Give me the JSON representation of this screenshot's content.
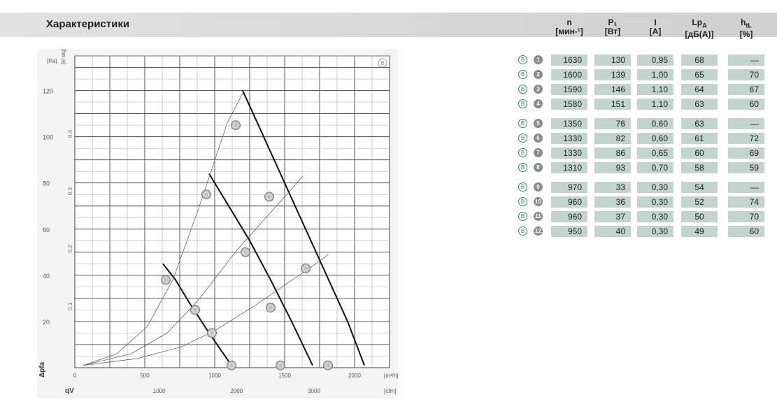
{
  "header": {
    "title": "Характеристики"
  },
  "table": {
    "columns": [
      {
        "name": "n",
        "unit": "[мин-¹]"
      },
      {
        "name": "P₁",
        "unit": "[Вт]"
      },
      {
        "name": "I",
        "unit": "[A]"
      },
      {
        "name": "Lp",
        "sub": "A",
        "unit": "[дБ(A)]"
      },
      {
        "name": "h",
        "sub": "tL",
        "unit": "[%]"
      }
    ],
    "rows": [
      {
        "badge": "B",
        "num": "1",
        "n": "1630",
        "p1": "130",
        "i": "0,95",
        "lpa": "68",
        "htl": "—"
      },
      {
        "badge": "B",
        "num": "2",
        "n": "1600",
        "p1": "139",
        "i": "1,00",
        "lpa": "65",
        "htl": "70"
      },
      {
        "badge": "B",
        "num": "3",
        "n": "1590",
        "p1": "146",
        "i": "1,10",
        "lpa": "64",
        "htl": "67"
      },
      {
        "badge": "B",
        "num": "4",
        "n": "1580",
        "p1": "151",
        "i": "1,10",
        "lpa": "63",
        "htl": "60"
      },
      {
        "badge": "B",
        "num": "5",
        "n": "1350",
        "p1": "76",
        "i": "0,60",
        "lpa": "63",
        "htl": "—"
      },
      {
        "badge": "B",
        "num": "6",
        "n": "1330",
        "p1": "82",
        "i": "0,60",
        "lpa": "61",
        "htl": "72"
      },
      {
        "badge": "B",
        "num": "7",
        "n": "1330",
        "p1": "86",
        "i": "0,65",
        "lpa": "60",
        "htl": "69"
      },
      {
        "badge": "B",
        "num": "8",
        "n": "1310",
        "p1": "93",
        "i": "0,70",
        "lpa": "58",
        "htl": "59"
      },
      {
        "badge": "B",
        "num": "9",
        "n": "970",
        "p1": "33",
        "i": "0,30",
        "lpa": "54",
        "htl": "—"
      },
      {
        "badge": "B",
        "num": "10",
        "n": "960",
        "p1": "36",
        "i": "0,30",
        "lpa": "52",
        "htl": "74"
      },
      {
        "badge": "B",
        "num": "11",
        "n": "960",
        "p1": "37",
        "i": "0,30",
        "lpa": "50",
        "htl": "70"
      },
      {
        "badge": "B",
        "num": "12",
        "n": "950",
        "p1": "40",
        "i": "0,30",
        "lpa": "49",
        "htl": "60"
      }
    ]
  },
  "chart_data": {
    "type": "line",
    "title": "",
    "corner_mark": "B",
    "x_axis_primary": {
      "label": "[m³/h]",
      "ticks": [
        "0",
        "500",
        "1000",
        "1500",
        "2000"
      ],
      "range": [
        0,
        2250
      ]
    },
    "x_axis_secondary": {
      "label": "[cfm]",
      "ticks": [
        "1000",
        "2000",
        "3000"
      ]
    },
    "y_axis_primary": {
      "label": "[Pa]",
      "ticks": [
        "20",
        "40",
        "60",
        "80",
        "100",
        "120"
      ],
      "range": [
        0,
        135
      ]
    },
    "y_axis_secondary": {
      "label": "[in wg]",
      "ticks": [
        "0.1",
        "0.2",
        "0.3",
        "0.4"
      ]
    },
    "x_symbol": "qV",
    "y_symbol": "Δpfa",
    "grid": true,
    "series": [
      {
        "kind": "fan-curve",
        "points": [
          [
            1200,
            120
          ],
          [
            1350,
            100
          ],
          [
            1500,
            80
          ],
          [
            1650,
            60
          ],
          [
            1800,
            40
          ],
          [
            1950,
            20
          ],
          [
            2070,
            1
          ]
        ]
      },
      {
        "kind": "fan-curve",
        "points": [
          [
            960,
            84
          ],
          [
            1100,
            70
          ],
          [
            1250,
            55
          ],
          [
            1400,
            38
          ],
          [
            1550,
            20
          ],
          [
            1700,
            1
          ]
        ]
      },
      {
        "kind": "fan-curve",
        "points": [
          [
            630,
            45
          ],
          [
            720,
            38
          ],
          [
            820,
            28
          ],
          [
            960,
            15
          ],
          [
            1120,
            1
          ]
        ]
      },
      {
        "kind": "system-curve",
        "points": [
          [
            60,
            1
          ],
          [
            300,
            6
          ],
          [
            520,
            18
          ],
          [
            700,
            38
          ],
          [
            880,
            68
          ],
          [
            1090,
            106
          ],
          [
            1210,
            120
          ]
        ]
      },
      {
        "kind": "system-curve",
        "points": [
          [
            60,
            1
          ],
          [
            400,
            6
          ],
          [
            660,
            15
          ],
          [
            880,
            29
          ],
          [
            1160,
            51
          ],
          [
            1530,
            76
          ],
          [
            1630,
            83
          ]
        ]
      },
      {
        "kind": "system-curve",
        "points": [
          [
            60,
            1
          ],
          [
            450,
            4
          ],
          [
            760,
            9
          ],
          [
            1000,
            16
          ],
          [
            1290,
            27
          ],
          [
            1700,
            44
          ],
          [
            1810,
            49
          ]
        ]
      }
    ],
    "operating_points": [
      {
        "label": "1",
        "x": 1120,
        "y": 1
      },
      {
        "label": "2",
        "x": 1470,
        "y": 1
      },
      {
        "label": "3",
        "x": 1810,
        "y": 1
      },
      {
        "label": "4",
        "x": 980,
        "y": 15
      },
      {
        "label": "5",
        "x": 860,
        "y": 25
      },
      {
        "label": "6",
        "x": 1400,
        "y": 26
      },
      {
        "label": "7",
        "x": 650,
        "y": 38
      },
      {
        "label": "8",
        "x": 1220,
        "y": 50
      },
      {
        "label": "9",
        "x": 1650,
        "y": 43
      },
      {
        "label": "10",
        "x": 940,
        "y": 75
      },
      {
        "label": "11",
        "x": 1390,
        "y": 74
      },
      {
        "label": "12",
        "x": 1150,
        "y": 105
      }
    ]
  }
}
